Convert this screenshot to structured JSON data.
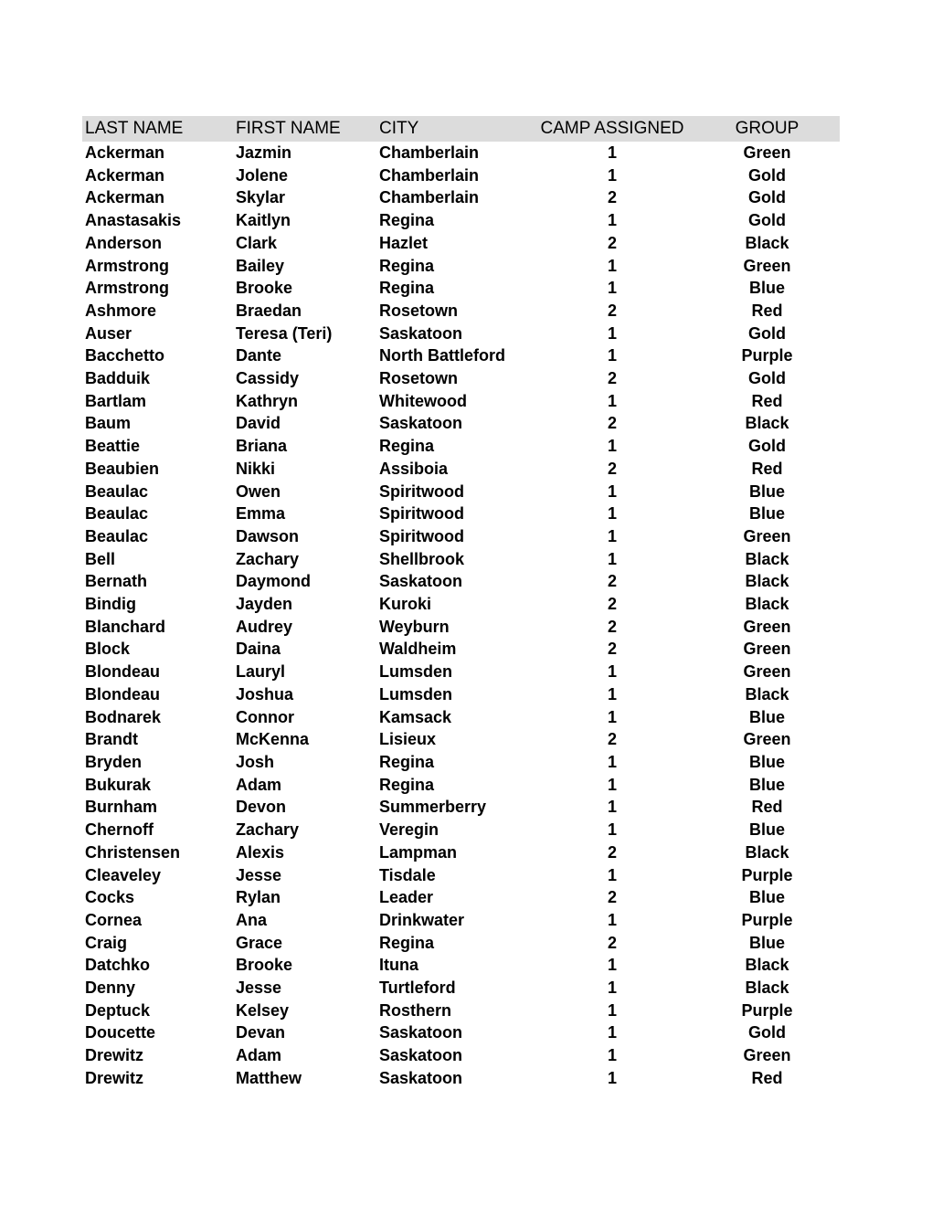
{
  "table": {
    "header_background": "#dcdcdc",
    "columns": [
      {
        "key": "last_name",
        "label": "LAST NAME"
      },
      {
        "key": "first_name",
        "label": "FIRST NAME"
      },
      {
        "key": "city",
        "label": "CITY"
      },
      {
        "key": "camp_assigned",
        "label": "CAMP ASSIGNED"
      },
      {
        "key": "group",
        "label": "GROUP"
      }
    ],
    "rows": [
      [
        "Ackerman",
        "Jazmin",
        "Chamberlain",
        "1",
        "Green"
      ],
      [
        "Ackerman",
        "Jolene",
        "Chamberlain",
        "1",
        "Gold"
      ],
      [
        "Ackerman",
        "Skylar",
        "Chamberlain",
        "2",
        "Gold"
      ],
      [
        "Anastasakis",
        "Kaitlyn",
        "Regina",
        "1",
        "Gold"
      ],
      [
        "Anderson",
        "Clark",
        "Hazlet",
        "2",
        "Black"
      ],
      [
        "Armstrong",
        "Bailey",
        "Regina",
        "1",
        "Green"
      ],
      [
        "Armstrong",
        "Brooke",
        "Regina",
        "1",
        "Blue"
      ],
      [
        "Ashmore",
        "Braedan",
        "Rosetown",
        "2",
        "Red"
      ],
      [
        "Auser",
        "Teresa (Teri)",
        "Saskatoon",
        "1",
        "Gold"
      ],
      [
        "Bacchetto",
        "Dante",
        "North Battleford",
        "1",
        "Purple"
      ],
      [
        "Badduik",
        "Cassidy",
        "Rosetown",
        "2",
        "Gold"
      ],
      [
        "Bartlam",
        "Kathryn",
        "Whitewood",
        "1",
        "Red"
      ],
      [
        "Baum",
        "David",
        "Saskatoon",
        "2",
        "Black"
      ],
      [
        "Beattie",
        "Briana",
        "Regina",
        "1",
        "Gold"
      ],
      [
        "Beaubien",
        "Nikki",
        "Assiboia",
        "2",
        "Red"
      ],
      [
        "Beaulac",
        "Owen",
        "Spiritwood",
        "1",
        "Blue"
      ],
      [
        "Beaulac",
        "Emma",
        "Spiritwood",
        "1",
        "Blue"
      ],
      [
        "Beaulac",
        "Dawson",
        "Spiritwood",
        "1",
        "Green"
      ],
      [
        "Bell",
        "Zachary",
        "Shellbrook",
        "1",
        "Black"
      ],
      [
        "Bernath",
        "Daymond",
        "Saskatoon",
        "2",
        "Black"
      ],
      [
        "Bindig",
        "Jayden",
        "Kuroki",
        "2",
        "Black"
      ],
      [
        "Blanchard",
        "Audrey",
        "Weyburn",
        "2",
        "Green"
      ],
      [
        "Block",
        "Daina",
        "Waldheim",
        "2",
        "Green"
      ],
      [
        "Blondeau",
        "Lauryl",
        "Lumsden",
        "1",
        "Green"
      ],
      [
        "Blondeau",
        "Joshua",
        "Lumsden",
        "1",
        "Black"
      ],
      [
        "Bodnarek",
        "Connor",
        "Kamsack",
        "1",
        "Blue"
      ],
      [
        "Brandt",
        "McKenna",
        "Lisieux",
        "2",
        "Green"
      ],
      [
        "Bryden",
        "Josh",
        "Regina",
        "1",
        "Blue"
      ],
      [
        "Bukurak",
        "Adam",
        "Regina",
        "1",
        "Blue"
      ],
      [
        "Burnham",
        "Devon",
        "Summerberry",
        "1",
        "Red"
      ],
      [
        "Chernoff",
        "Zachary",
        "Veregin",
        "1",
        "Blue"
      ],
      [
        "Christensen",
        "Alexis",
        "Lampman",
        "2",
        "Black"
      ],
      [
        "Cleaveley",
        "Jesse",
        "Tisdale",
        "1",
        "Purple"
      ],
      [
        "Cocks",
        "Rylan",
        "Leader",
        "2",
        "Blue"
      ],
      [
        "Cornea",
        "Ana",
        "Drinkwater",
        "1",
        "Purple"
      ],
      [
        "Craig",
        "Grace",
        "Regina",
        "2",
        "Blue"
      ],
      [
        "Datchko",
        "Brooke",
        "Ituna",
        "1",
        "Black"
      ],
      [
        "Denny",
        "Jesse",
        "Turtleford",
        "1",
        "Black"
      ],
      [
        "Deptuck",
        "Kelsey",
        "Rosthern",
        "1",
        "Purple"
      ],
      [
        "Doucette",
        "Devan",
        "Saskatoon",
        "1",
        "Gold"
      ],
      [
        "Drewitz",
        "Adam",
        "Saskatoon",
        "1",
        "Green"
      ],
      [
        "Drewitz",
        "Matthew",
        "Saskatoon",
        "1",
        "Red"
      ]
    ]
  }
}
